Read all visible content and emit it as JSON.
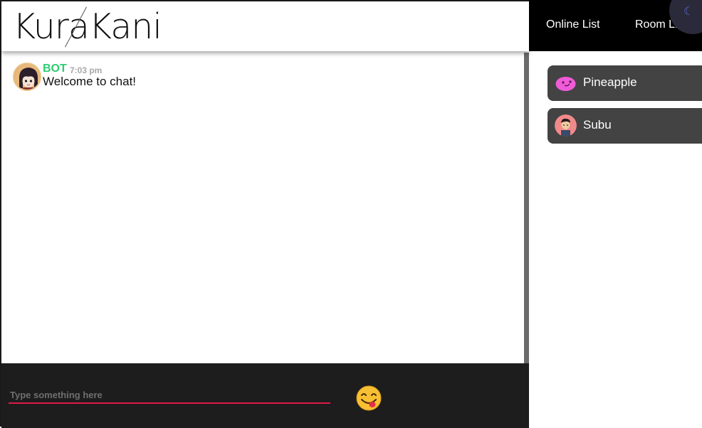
{
  "app": {
    "logo": "KuraKani"
  },
  "nav": {
    "online_list": "Online List",
    "room_list": "Room List"
  },
  "chat": {
    "messages": [
      {
        "sender": "BOT",
        "time": "7:03 pm",
        "text": "Welcome to chat!"
      }
    ]
  },
  "composer": {
    "placeholder": "Type something here",
    "value": ""
  },
  "online_users": [
    {
      "name": "Pineapple",
      "avatar": "pink-blob-avatar"
    },
    {
      "name": "Subu",
      "avatar": "boy-avatar"
    }
  ],
  "icons": {
    "theme": "moon-icon",
    "emoji": "smiley-emoji-icon"
  },
  "colors": {
    "accent_underline": "#e0194a",
    "bot_name": "#2ecc71",
    "user_card": "#434343",
    "nav_bg": "#000000",
    "composer_bg": "#1d1d1d"
  }
}
